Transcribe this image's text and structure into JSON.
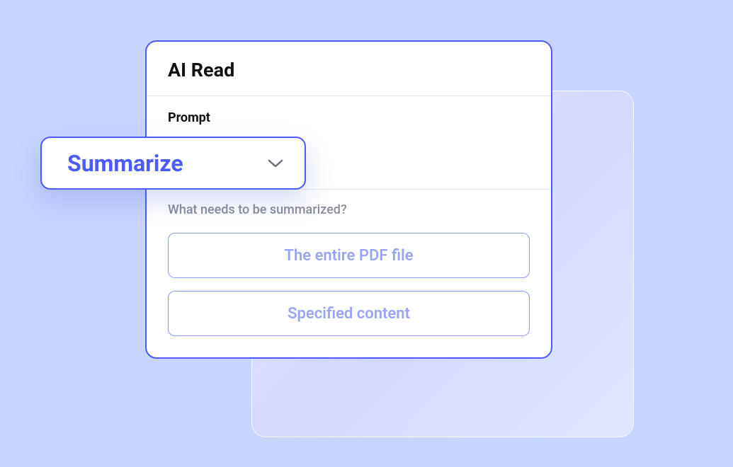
{
  "card": {
    "title": "AI Read",
    "prompt_label": "Prompt",
    "question": "What needs to be summarized?",
    "options": [
      "The entire PDF file",
      "Specified content"
    ]
  },
  "dropdown": {
    "selected": "Summarize"
  },
  "colors": {
    "primary": "#4a5cff",
    "background": "#c8d5ff",
    "option_text": "#9aa4f5",
    "muted_text": "#8a8d9a"
  }
}
